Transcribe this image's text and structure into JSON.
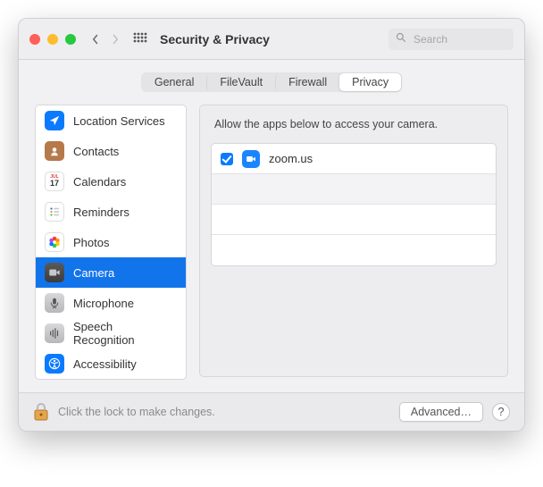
{
  "window": {
    "title": "Security & Privacy"
  },
  "search": {
    "placeholder": "Search",
    "value": ""
  },
  "tabs": {
    "items": [
      {
        "label": "General",
        "active": false
      },
      {
        "label": "FileVault",
        "active": false
      },
      {
        "label": "Firewall",
        "active": false
      },
      {
        "label": "Privacy",
        "active": true
      }
    ]
  },
  "sidebar": {
    "items": [
      {
        "id": "location-services",
        "label": "Location Services",
        "selected": false
      },
      {
        "id": "contacts",
        "label": "Contacts",
        "selected": false
      },
      {
        "id": "calendars",
        "label": "Calendars",
        "selected": false
      },
      {
        "id": "reminders",
        "label": "Reminders",
        "selected": false
      },
      {
        "id": "photos",
        "label": "Photos",
        "selected": false
      },
      {
        "id": "camera",
        "label": "Camera",
        "selected": true
      },
      {
        "id": "microphone",
        "label": "Microphone",
        "selected": false
      },
      {
        "id": "speech-recognition",
        "label": "Speech Recognition",
        "selected": false
      },
      {
        "id": "accessibility",
        "label": "Accessibility",
        "selected": false
      }
    ]
  },
  "pane": {
    "description": "Allow the apps below to access your camera.",
    "apps": [
      {
        "name": "zoom.us",
        "checked": true
      }
    ]
  },
  "footer": {
    "lock_text": "Click the lock to make changes.",
    "advanced_label": "Advanced…",
    "help_label": "?"
  },
  "colors": {
    "accent": "#1274ea",
    "check": "#0a7aff"
  }
}
